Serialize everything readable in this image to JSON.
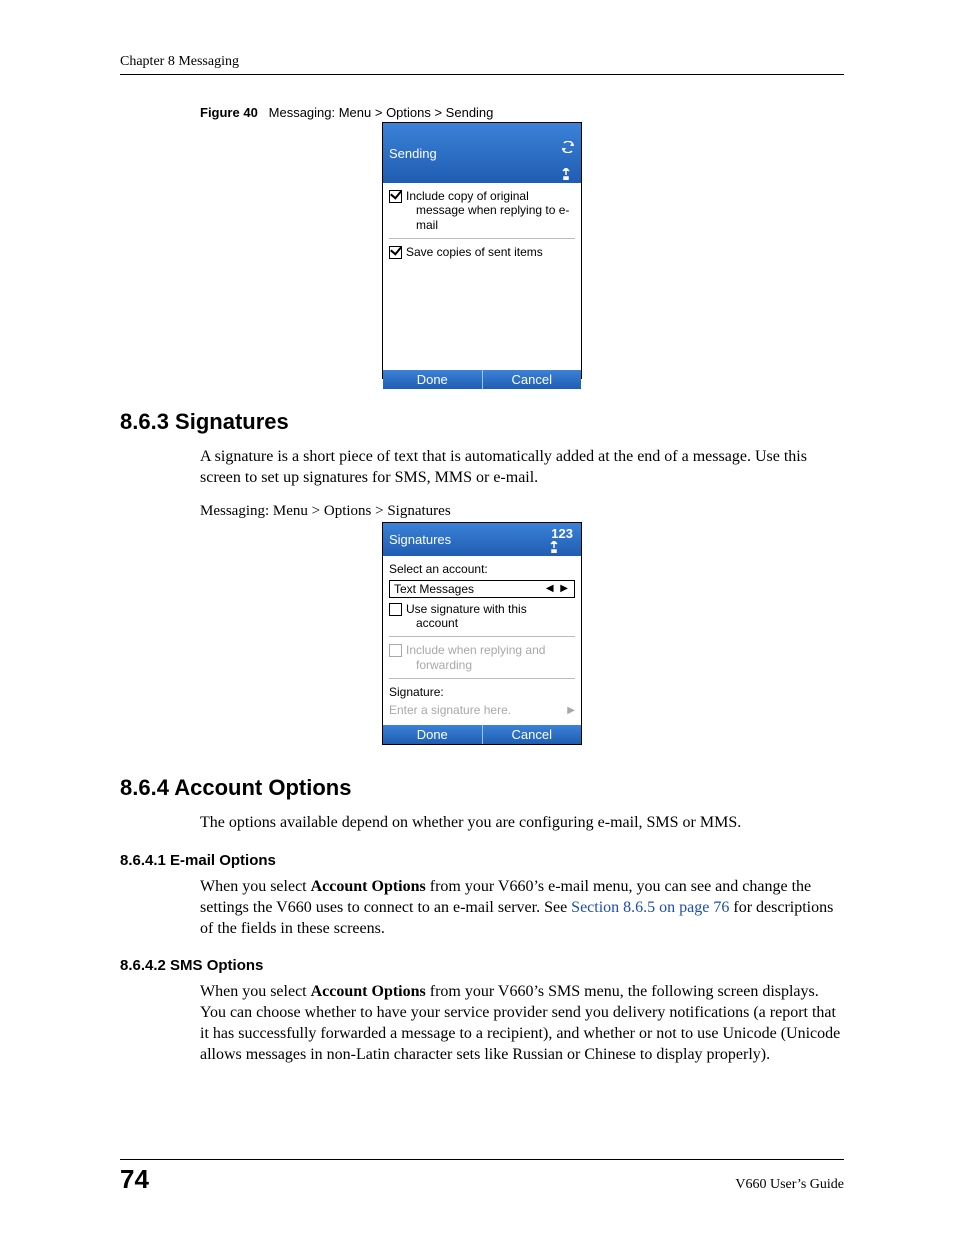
{
  "header": {
    "chapter": "Chapter 8 Messaging"
  },
  "fig40": {
    "label": "Figure 40",
    "caption": "Messaging: Menu > Options > Sending",
    "screen": {
      "title": "Sending",
      "opt1_line1": "Include copy of original",
      "opt1_line2": "message when replying to e-",
      "opt1_line3": "mail",
      "opt2": "Save copies of sent items",
      "done": "Done",
      "cancel": "Cancel"
    }
  },
  "s863": {
    "heading": "8.6.3  Signatures",
    "body": "A signature is a short piece of text that is automatically added at the end of a message. Use this screen to set up signatures for SMS, MMS or e-mail.",
    "caption": "Messaging: Menu > Options > Signatures",
    "screen": {
      "title": "Signatures",
      "status": "123",
      "select_label": "Select an account:",
      "account": "Text Messages",
      "use_sig_line1": "Use signature with this",
      "use_sig_line2": "account",
      "include_line1": "Include when replying and",
      "include_line2": "forwarding",
      "sig_label": "Signature:",
      "sig_placeholder": "Enter a signature here.",
      "done": "Done",
      "cancel": "Cancel"
    }
  },
  "s864": {
    "heading": "8.6.4  Account Options",
    "body": "The options available depend on whether you are configuring e-mail, SMS or MMS."
  },
  "s8641": {
    "heading": "8.6.4.1  E-mail Options",
    "body_pre": "When you select ",
    "body_bold": "Account Options",
    "body_mid": " from your V660’s e-mail menu, you can see and change the settings the V660 uses to connect to an e-mail server. See ",
    "body_link": "Section 8.6.5 on page 76",
    "body_post": " for descriptions of the fields in these screens."
  },
  "s8642": {
    "heading": "8.6.4.2  SMS Options",
    "body_pre": "When you select ",
    "body_bold": "Account Options",
    "body_post": " from your V660’s SMS menu, the following screen displays. You can choose whether to have your service provider send you delivery notifications (a report that it has successfully forwarded a message to a recipient), and whether or not to use Unicode (Unicode allows messages in non-Latin character sets like Russian or Chinese to display properly)."
  },
  "footer": {
    "page": "74",
    "guide": "V660 User’s Guide"
  }
}
